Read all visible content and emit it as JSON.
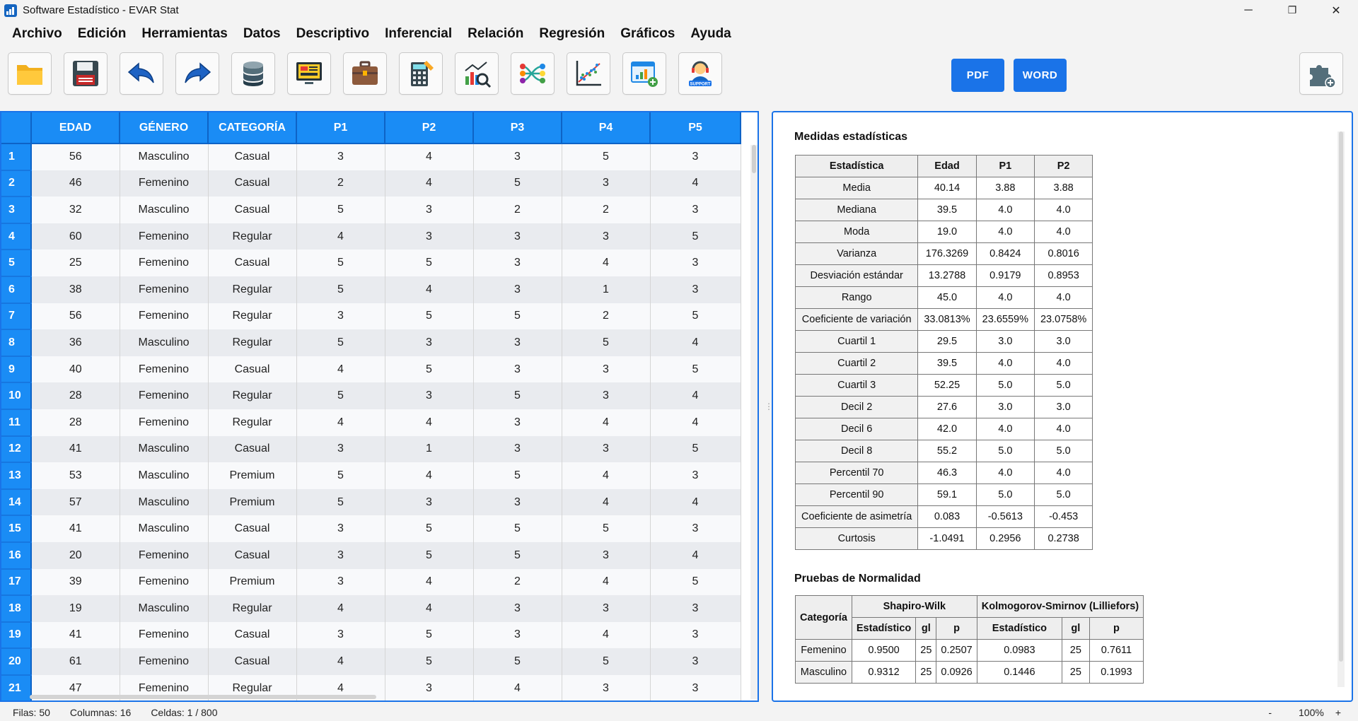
{
  "window": {
    "title": "Software Estadístico - EVAR Stat",
    "minimize": "─",
    "maximize": "❐",
    "close": "✕"
  },
  "menu": [
    "Archivo",
    "Edición",
    "Herramientas",
    "Datos",
    "Descriptivo",
    "Inferencial",
    "Relación",
    "Regresión",
    "Gráficos",
    "Ayuda"
  ],
  "toolbar": {
    "tools": [
      "open-folder",
      "save",
      "undo",
      "redo",
      "database",
      "data-view",
      "briefcase",
      "calculator",
      "chart-analysis",
      "network",
      "scatter-plot",
      "add-report",
      "support"
    ],
    "support_label": "SUPPORT",
    "pdf_label": "PDF",
    "word_label": "WORD",
    "colors": {
      "accent": "#1a73e8",
      "grid_header": "#1a8cf5"
    }
  },
  "grid": {
    "columns": [
      "EDAD",
      "GÉNERO",
      "CATEGORÍA",
      "P1",
      "P2",
      "P3",
      "P4",
      "P5"
    ],
    "rows": [
      [
        "1",
        "56",
        "Masculino",
        "Casual",
        "3",
        "4",
        "3",
        "5",
        "3"
      ],
      [
        "2",
        "46",
        "Femenino",
        "Casual",
        "2",
        "4",
        "5",
        "3",
        "4"
      ],
      [
        "3",
        "32",
        "Masculino",
        "Casual",
        "5",
        "3",
        "2",
        "2",
        "3"
      ],
      [
        "4",
        "60",
        "Femenino",
        "Regular",
        "4",
        "3",
        "3",
        "3",
        "5"
      ],
      [
        "5",
        "25",
        "Femenino",
        "Casual",
        "5",
        "5",
        "3",
        "4",
        "3"
      ],
      [
        "6",
        "38",
        "Femenino",
        "Regular",
        "5",
        "4",
        "3",
        "1",
        "3"
      ],
      [
        "7",
        "56",
        "Femenino",
        "Regular",
        "3",
        "5",
        "5",
        "2",
        "5"
      ],
      [
        "8",
        "36",
        "Masculino",
        "Regular",
        "5",
        "3",
        "3",
        "5",
        "4"
      ],
      [
        "9",
        "40",
        "Femenino",
        "Casual",
        "4",
        "5",
        "3",
        "3",
        "5"
      ],
      [
        "10",
        "28",
        "Femenino",
        "Regular",
        "5",
        "3",
        "5",
        "3",
        "4"
      ],
      [
        "11",
        "28",
        "Femenino",
        "Regular",
        "4",
        "4",
        "3",
        "4",
        "4"
      ],
      [
        "12",
        "41",
        "Masculino",
        "Casual",
        "3",
        "1",
        "3",
        "3",
        "5"
      ],
      [
        "13",
        "53",
        "Masculino",
        "Premium",
        "5",
        "4",
        "5",
        "4",
        "3"
      ],
      [
        "14",
        "57",
        "Masculino",
        "Premium",
        "5",
        "3",
        "3",
        "4",
        "4"
      ],
      [
        "15",
        "41",
        "Masculino",
        "Casual",
        "3",
        "5",
        "5",
        "5",
        "3"
      ],
      [
        "16",
        "20",
        "Femenino",
        "Casual",
        "3",
        "5",
        "5",
        "3",
        "4"
      ],
      [
        "17",
        "39",
        "Femenino",
        "Premium",
        "3",
        "4",
        "2",
        "4",
        "5"
      ],
      [
        "18",
        "19",
        "Masculino",
        "Regular",
        "4",
        "4",
        "3",
        "3",
        "3"
      ],
      [
        "19",
        "41",
        "Femenino",
        "Casual",
        "3",
        "5",
        "3",
        "4",
        "3"
      ],
      [
        "20",
        "61",
        "Femenino",
        "Casual",
        "4",
        "5",
        "5",
        "5",
        "3"
      ],
      [
        "21",
        "47",
        "Femenino",
        "Regular",
        "4",
        "3",
        "4",
        "3",
        "3"
      ]
    ]
  },
  "results": {
    "stats_title": "Medidas estadísticas",
    "stats_headers": [
      "Estadística",
      "Edad",
      "P1",
      "P2"
    ],
    "stats_rows": [
      [
        "Media",
        "40.14",
        "3.88",
        "3.88"
      ],
      [
        "Mediana",
        "39.5",
        "4.0",
        "4.0"
      ],
      [
        "Moda",
        "19.0",
        "4.0",
        "4.0"
      ],
      [
        "Varianza",
        "176.3269",
        "0.8424",
        "0.8016"
      ],
      [
        "Desviación estándar",
        "13.2788",
        "0.9179",
        "0.8953"
      ],
      [
        "Rango",
        "45.0",
        "4.0",
        "4.0"
      ],
      [
        "Coeficiente de variación",
        "33.0813%",
        "23.6559%",
        "23.0758%"
      ],
      [
        "Cuartil 1",
        "29.5",
        "3.0",
        "3.0"
      ],
      [
        "Cuartil 2",
        "39.5",
        "4.0",
        "4.0"
      ],
      [
        "Cuartil 3",
        "52.25",
        "5.0",
        "5.0"
      ],
      [
        "Decil 2",
        "27.6",
        "3.0",
        "3.0"
      ],
      [
        "Decil 6",
        "42.0",
        "4.0",
        "4.0"
      ],
      [
        "Decil 8",
        "55.2",
        "5.0",
        "5.0"
      ],
      [
        "Percentil 70",
        "46.3",
        "4.0",
        "4.0"
      ],
      [
        "Percentil 90",
        "59.1",
        "5.0",
        "5.0"
      ],
      [
        "Coeficiente de asimetría",
        "0.083",
        "-0.5613",
        "-0.453"
      ],
      [
        "Curtosis",
        "-1.0491",
        "0.2956",
        "0.2738"
      ]
    ],
    "norm_title": "Pruebas de Normalidad",
    "norm_category_header": "Categoría",
    "norm_group_headers": [
      "Shapiro-Wilk",
      "Kolmogorov-Smirnov (Lilliefors)"
    ],
    "norm_sub_headers": [
      "Estadístico",
      "gl",
      "p",
      "Estadístico",
      "gl",
      "p"
    ],
    "norm_rows": [
      [
        "Femenino",
        "0.9500",
        "25",
        "0.2507",
        "0.0983",
        "25",
        "0.7611"
      ],
      [
        "Masculino",
        "0.9312",
        "25",
        "0.0926",
        "0.1446",
        "25",
        "0.1993"
      ]
    ]
  },
  "status": {
    "rows": "Filas: 50",
    "columns": "Columnas: 16",
    "cells": "Celdas: 1 / 800",
    "zoom_out": "-",
    "zoom": "100%",
    "zoom_in": "+"
  }
}
